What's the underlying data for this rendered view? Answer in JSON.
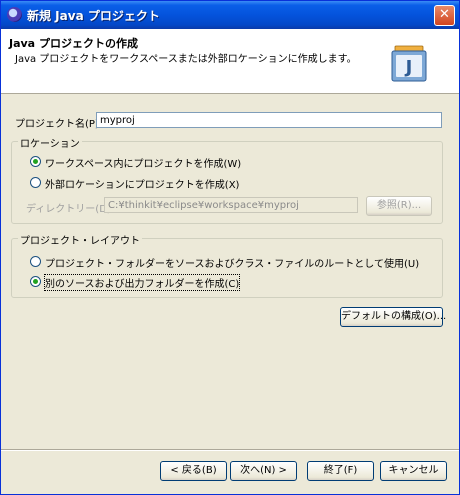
{
  "window": {
    "title": "新規 Java プロジェクト",
    "close_glyph": "✕"
  },
  "header": {
    "title": "Java プロジェクトの作成",
    "description": "Java プロジェクトをワークスペースまたは外部ロケーションに作成します。",
    "image_letter": "J"
  },
  "project_name": {
    "label": "プロジェクト名(P):",
    "value": "myproj"
  },
  "location": {
    "group_title": "ロケーション",
    "options": [
      {
        "label": "ワークスペース内にプロジェクトを作成(W)",
        "selected": true
      },
      {
        "label": "外部ロケーションにプロジェクトを作成(X)",
        "selected": false
      }
    ],
    "directory_label": "ディレクトリー(D):",
    "directory_value": "C:¥thinkit¥eclipse¥workspace¥myproj",
    "browse_label": "参照(R)..."
  },
  "layout": {
    "group_title": "プロジェクト・レイアウト",
    "options": [
      {
        "label": "プロジェクト・フォルダーをソースおよびクラス・ファイルのルートとして使用(U)",
        "selected": false
      },
      {
        "label": "別のソースおよび出力フォルダーを作成(C)",
        "selected": true
      }
    ],
    "defaults_button": "デフォルトの構成(O)..."
  },
  "buttons": {
    "back": "< 戻る(B)",
    "next": "次へ(N) >",
    "finish": "終了(F)",
    "cancel": "キャンセル"
  }
}
